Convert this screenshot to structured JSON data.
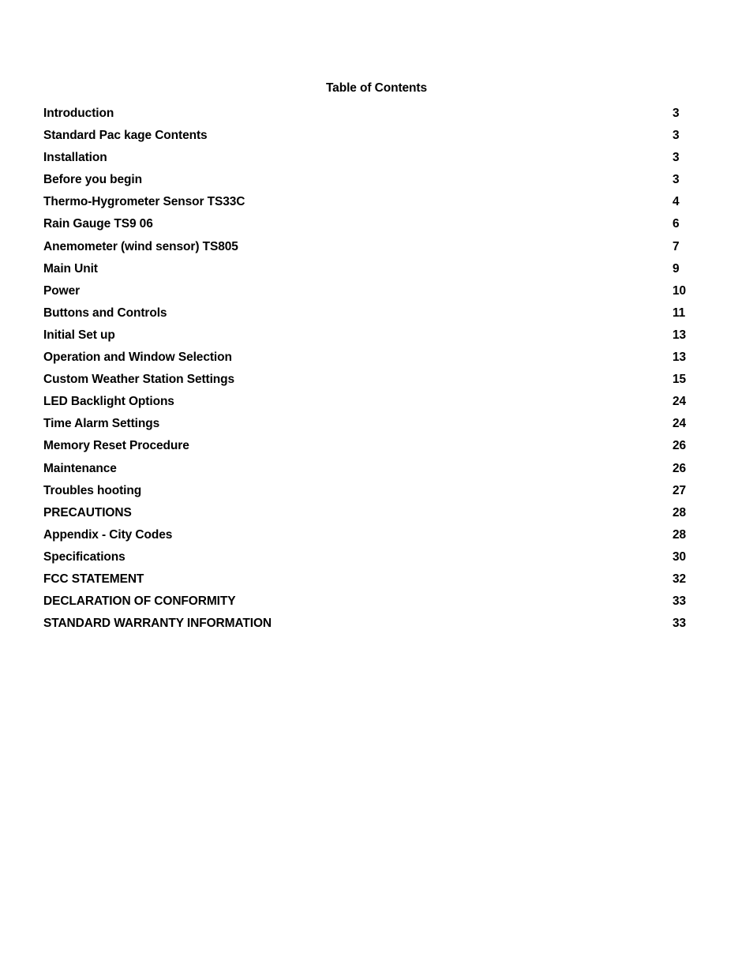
{
  "document": {
    "title": "Table of Contents",
    "background_color": "#ffffff",
    "text_color": "#000000"
  },
  "toc": {
    "heading": "Table of Contents",
    "entries": [
      {
        "label": "Introduction",
        "page": "3"
      },
      {
        "label": "Standard Pac kage Contents",
        "page": "3"
      },
      {
        "label": "Installation",
        "page": "3"
      },
      {
        "label": "Before you begin",
        "page": "3"
      },
      {
        "label": "Thermo-Hygrometer Sensor TS33C",
        "page": "4"
      },
      {
        "label": "Rain Gauge TS9 06",
        "page": "6"
      },
      {
        "label": "Anemometer (wind sensor) TS805",
        "page": "7"
      },
      {
        "label": "Main Unit",
        "page": "9"
      },
      {
        "label": "Power",
        "page": "10"
      },
      {
        "label": "Buttons and Controls",
        "page": "11"
      },
      {
        "label": "Initial Set up",
        "page": "13"
      },
      {
        "label": "Operation and Window Selection",
        "page": "13"
      },
      {
        "label": "Custom Weather Station Settings",
        "page": "15"
      },
      {
        "label": "LED Backlight Options",
        "page": "24"
      },
      {
        "label": "Time Alarm Settings",
        "page": "24"
      },
      {
        "label": "Memory Reset Procedure",
        "page": "26"
      },
      {
        "label": "Maintenance",
        "page": "26"
      },
      {
        "label": "Troubles hooting",
        "page": "27"
      },
      {
        "label": "PRECAUTIONS",
        "page": "28"
      },
      {
        "label": "Appendix - City Codes",
        "page": "28"
      },
      {
        "label": "Specifications",
        "page": "30"
      },
      {
        "label": "FCC STATEMENT",
        "page": "32"
      },
      {
        "label": "DECLARATION OF CONFORMITY",
        "page": "33"
      },
      {
        "label": "STANDARD WARRANTY INFORMATION",
        "page": "33"
      }
    ]
  }
}
